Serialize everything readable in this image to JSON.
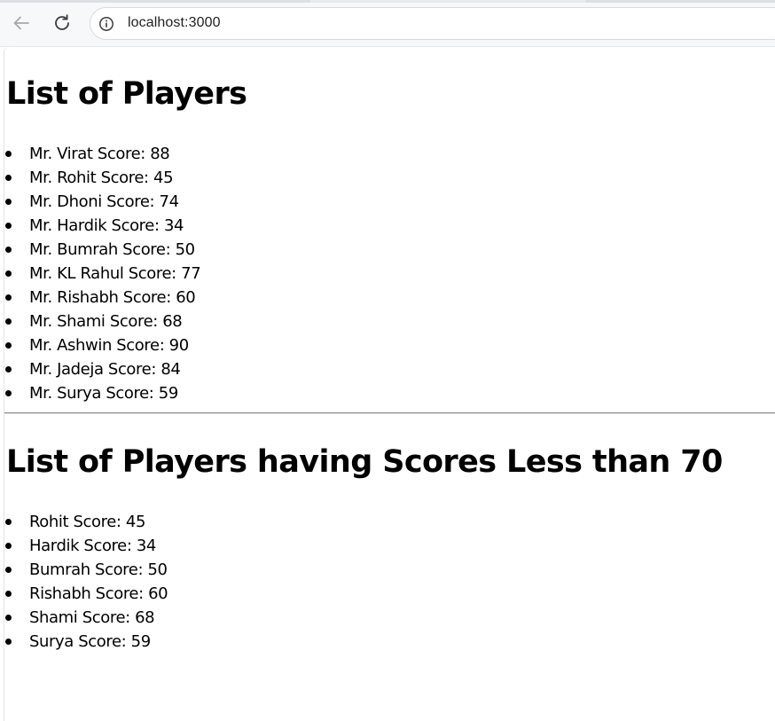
{
  "browser": {
    "url": "localhost:3000",
    "icons": {
      "back": "arrow-left-icon",
      "reload": "reload-icon",
      "site_info": "info-circle-icon"
    }
  },
  "page": {
    "all_players": {
      "title": "List of Players",
      "items": [
        "Mr. Virat Score: 88",
        "Mr. Rohit Score: 45",
        "Mr. Dhoni Score: 74",
        "Mr. Hardik Score: 34",
        "Mr. Bumrah Score: 50",
        "Mr. KL Rahul Score: 77",
        "Mr. Rishabh Score: 60",
        "Mr. Shami Score: 68",
        "Mr. Ashwin Score: 90",
        "Mr. Jadeja Score: 84",
        "Mr. Surya Score: 59"
      ]
    },
    "low_scorers": {
      "title": "List of Players having Scores Less than 70",
      "items": [
        "Rohit Score: 45",
        "Hardik Score: 34",
        "Bumrah Score: 50",
        "Rishabh Score: 60",
        "Shami Score: 68",
        "Surya Score: 59"
      ]
    }
  }
}
